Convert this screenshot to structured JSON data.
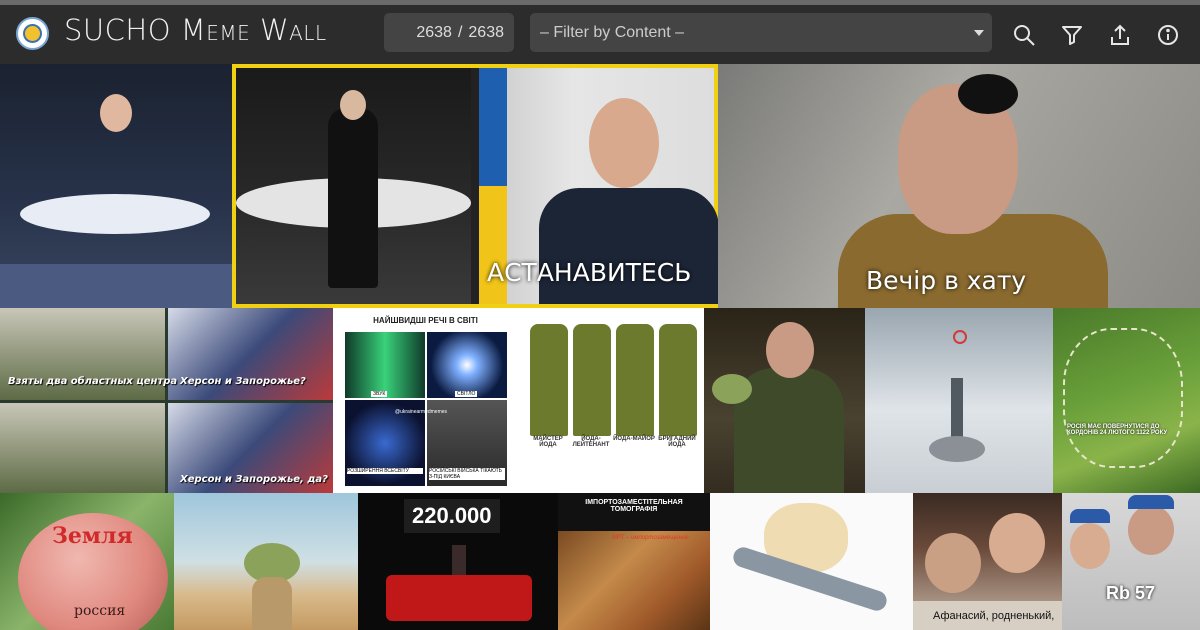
{
  "app": {
    "title": "SUCHO Meme Wall",
    "logo_icon": "sucho-logo-icon"
  },
  "toolbar": {
    "count_current": "2638",
    "count_separator": "/",
    "count_total": "2638",
    "filter_placeholder": "– Filter by Content –",
    "icons": [
      "search-icon",
      "filter-icon",
      "share-icon",
      "info-icon"
    ]
  },
  "colors": {
    "topbar_bg": "#2c2c2c",
    "field_bg": "#444444",
    "selection_outline": "#f0d012"
  },
  "memes": {
    "astanavites": "АСТАНАВИТЕСЬ",
    "vechir": "Вечір в хату",
    "cap_top_left": "Взяты два областных центра",
    "cap_top_right": "Херсон и Запорожье?",
    "cap_bottom_right": "Херсон и Запорожье, да?",
    "fastest_title": "НАЙШВИДШІ РЕЧІ В СВІТІ",
    "fastest_sound": "ЗВУК",
    "fastest_light": "СВІТЛО",
    "fastest_handle": "@ukrainearmedmemes",
    "fastest_universe": "РОЗШИРЕННЯ ВСЕСВІТУ",
    "fastest_troops": "РОСІЙСЬКІ ВІЙСЬКА ТІКАЮТЬ З-ПІД КИЄВА",
    "yoda_ranks": [
      "МАЙСТЕР ЙОДА",
      "ЙОДА-ЛЕЙТЕНАНТ",
      "ЙОДА-МАЙОР",
      "БРИГАДНИЙ ЙОДА"
    ],
    "map_text": "РОСІЯ МАЄ ПОВЕРНУТИСЯ ДО КОРДОНІВ 24 ЛЮТОГО 1122 РОКУ",
    "zemlya": "Земля",
    "rossiya": "россия",
    "count_220": "220.000",
    "tomography_title": "ІМПОРТОЗАМЕСТІТЕЛЬНАЯ ТОМОГРАФІЯ",
    "tomography_sub": "МРТ – импортозамещение",
    "afanasiy": "Афанасий, родненький,",
    "rb57": "Rb 57"
  }
}
